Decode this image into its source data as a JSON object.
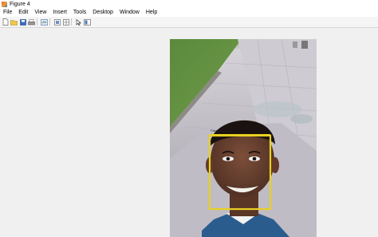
{
  "window": {
    "title": "Figure 4"
  },
  "menu": [
    "File",
    "Edit",
    "View",
    "Insert",
    "Tools",
    "Desktop",
    "Window",
    "Help"
  ],
  "toolbar": {
    "buttons": [
      "new-figure-icon",
      "open-file-icon",
      "save-icon",
      "print-icon",
      "export-icon",
      "link-icon",
      "data-cursor-icon",
      "pointer-icon",
      "property-editor-icon"
    ]
  },
  "figure": {
    "image_description": "selfie photo on a paved walkway with grass",
    "detection_box": {
      "label": "Face detected",
      "color": "#e8d021"
    }
  },
  "colors": {
    "window_bg": "#f0f0f0",
    "titlebar_bg": "#ffffff",
    "box": "#e8d021"
  }
}
